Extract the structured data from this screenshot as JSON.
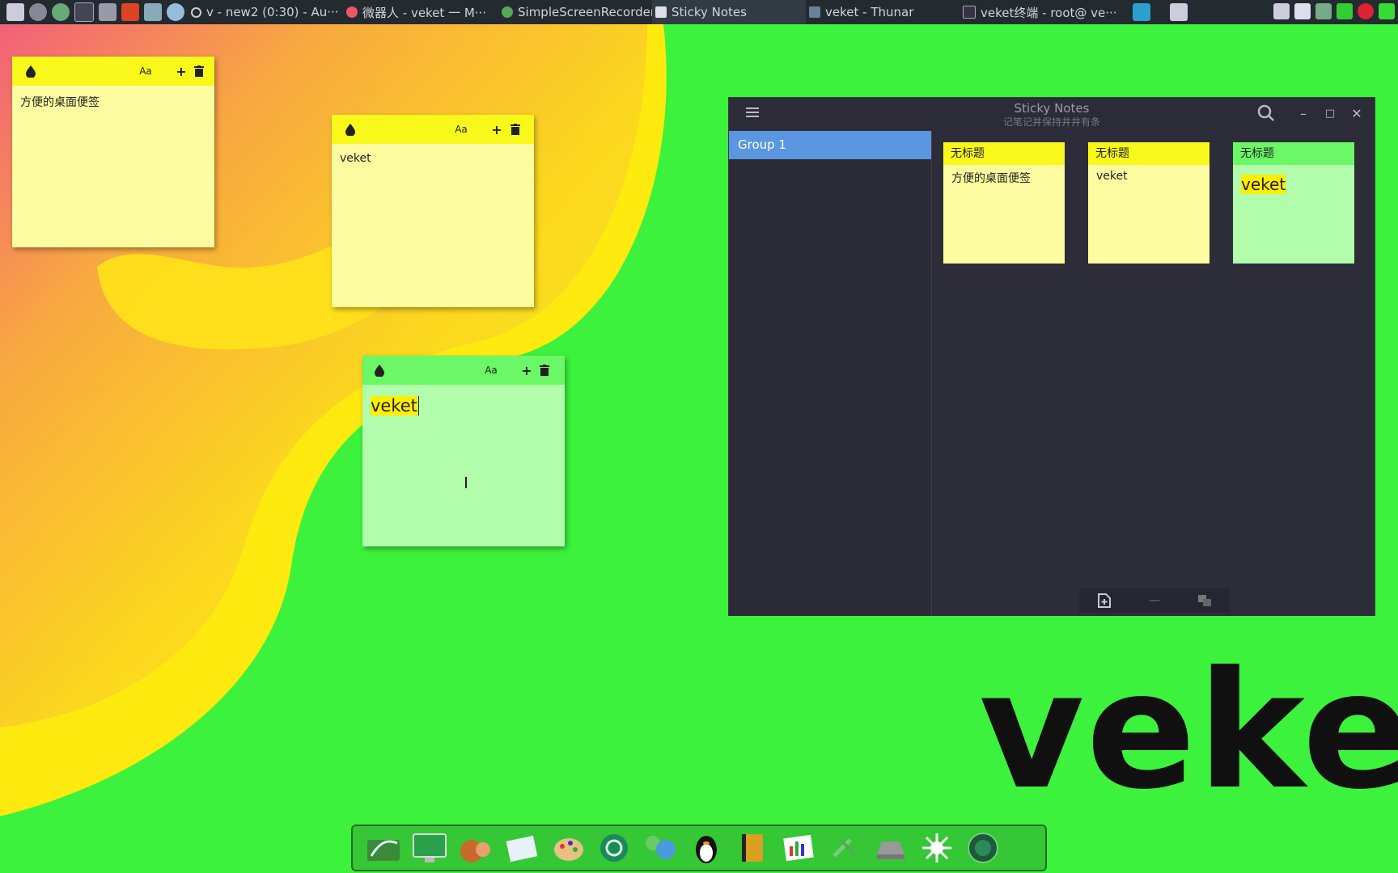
{
  "taskbar": {
    "tasks": [
      {
        "label": "v - new2 (0:30) - Au···",
        "icon": "record-icon"
      },
      {
        "label": "微器人 - veket 一 M···",
        "icon": "browser-icon"
      },
      {
        "label": "SimpleScreenRecorder",
        "icon": "recorder-icon"
      },
      {
        "label": "Sticky Notes",
        "icon": "sticky-notes-icon"
      },
      {
        "label": "veket - Thunar",
        "icon": "folder-icon"
      },
      {
        "label": "veket终端 - root@ ve···",
        "icon": "terminal-icon"
      }
    ]
  },
  "desktop_notes": [
    {
      "id": "note1",
      "color": "yellow",
      "text": "方便的桌面便签"
    },
    {
      "id": "note2",
      "color": "yellow",
      "text": "veket"
    },
    {
      "id": "note3",
      "color": "green",
      "text": "veket"
    }
  ],
  "note_toolbar": {
    "color_icon": "droplet-icon",
    "font_icon": "font-size-icon",
    "add_icon": "plus-icon",
    "delete_icon": "trash-icon",
    "font_glyph": "Aa",
    "add_glyph": "+"
  },
  "sticky_window": {
    "title": "Sticky Notes",
    "subtitle": "记笔记并保持井井有条",
    "groups": [
      "Group 1"
    ],
    "cards": [
      {
        "title": "无标题",
        "text": "方便的桌面便签",
        "color": "yellow"
      },
      {
        "title": "无标题",
        "text": "veket",
        "color": "yellow"
      },
      {
        "title": "无标题",
        "text": "veket",
        "color": "green"
      }
    ],
    "minimize_glyph": "–",
    "maximize_glyph": "□",
    "close_glyph": "✕",
    "remove_glyph": "—"
  },
  "wallpaper_text": "veket",
  "colors": {
    "note_yellow": "#fdfca0",
    "note_yellow_bar": "#f8f81a",
    "note_green": "#b2fdab",
    "note_green_bar": "#6cf766",
    "accent": "#5b96e0",
    "desktop_green": "#3cf23c"
  },
  "dock": {
    "items": [
      "files-icon",
      "monitor-icon",
      "squirrel-icon",
      "notepad-icon",
      "paint-icon",
      "power-icon",
      "network-icon",
      "penguin-icon",
      "book-icon",
      "chart-icon",
      "tools-icon",
      "drive-icon",
      "settings-icon",
      "globe-icon"
    ]
  }
}
